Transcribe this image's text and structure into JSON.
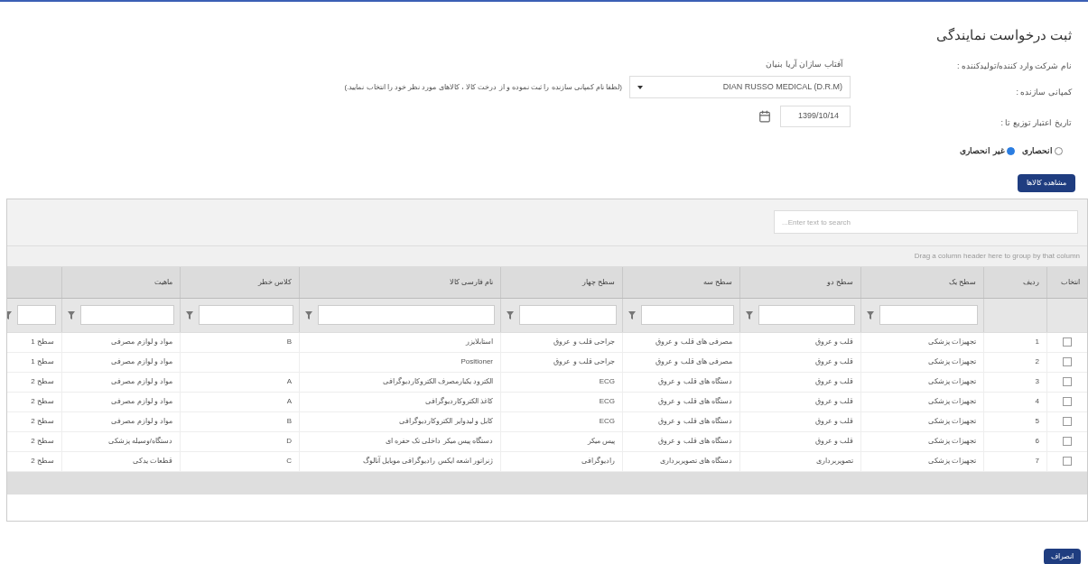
{
  "title": "ثبت درخواست نمایندگی",
  "form": {
    "company_label": "نام شرکت وارد کننده/تولیدکننده :",
    "company_value": "آفتاب سازان آریا بنیان",
    "manufacturer_label": "کمپانی سازنده :",
    "manufacturer_value": "DIAN RUSSO MEDICAL (D.R.M)",
    "manufacturer_hint": "(لطفا نام کمپانی سازنده را ثبت نموده و از درخت کالا ، کالاهای مورد نظر خود را انتخاب نمایید.)",
    "date_label": "تاریخ اعتبار توزیع تا :",
    "date_value": "1399/10/14",
    "radios": [
      {
        "label": "انحصاری",
        "selected": false
      },
      {
        "label": "غیر انحصاری",
        "selected": true
      }
    ],
    "view_button": "مشاهده کالاها"
  },
  "grid": {
    "search_placeholder": "Enter text to search...",
    "group_panel": "Drag a column header here to group by that column",
    "select_column_label": "انتخاب",
    "columns": [
      {
        "label": "ردیف",
        "kind": "plain"
      },
      {
        "label": "سطح یک",
        "kind": "filter"
      },
      {
        "label": "سطح دو",
        "kind": "filter"
      },
      {
        "label": "سطح سه",
        "kind": "filter"
      },
      {
        "label": "سطح چهار",
        "kind": "filter"
      },
      {
        "label": "نام فارسی کالا",
        "kind": "filter"
      },
      {
        "label": "کلاس خطر",
        "kind": "filter"
      },
      {
        "label": "ماهیت",
        "kind": "filter"
      },
      {
        "kind": "filter"
      }
    ],
    "rows": [
      {
        "checked": false,
        "cells": [
          "1",
          "تجهیزات پزشکی",
          "قلب و عروق",
          "مصرفی های قلب و عروق",
          "جراحی قلب و عروق",
          "استابلایزر",
          "B",
          "مواد و لوازم مصرفی",
          "سطح 1"
        ]
      },
      {
        "checked": false,
        "cells": [
          "2",
          "تجهیزات پزشکی",
          "قلب و عروق",
          "مصرفی های قلب و عروق",
          "جراحی قلب و عروق",
          "Positioner",
          "",
          "مواد و لوازم مصرفی",
          "سطح 1"
        ]
      },
      {
        "checked": false,
        "cells": [
          "3",
          "تجهیزات پزشکی",
          "قلب و عروق",
          "دستگاه های قلب و عروق",
          "ECG",
          "الکترود یکبارمصرف الکتروکاردیوگرافی",
          "A",
          "مواد و لوازم مصرفی",
          "سطح 2"
        ]
      },
      {
        "checked": false,
        "cells": [
          "4",
          "تجهیزات پزشکی",
          "قلب و عروق",
          "دستگاه های قلب و عروق",
          "ECG",
          "کاغذ الکتروکاردیوگرافی",
          "A",
          "مواد و لوازم مصرفی",
          "سطح 2"
        ]
      },
      {
        "checked": false,
        "cells": [
          "5",
          "تجهیزات پزشکی",
          "قلب و عروق",
          "دستگاه های قلب و عروق",
          "ECG",
          "کابل و لیدوایر الکتروکاردیوگرافی",
          "B",
          "مواد و لوازم مصرفی",
          "سطح 2"
        ]
      },
      {
        "checked": false,
        "cells": [
          "6",
          "تجهیزات پزشکی",
          "قلب و عروق",
          "دستگاه های قلب و عروق",
          "پیس میکر",
          "دستگاه پیس میکر داخلی تک حفره ای",
          "D",
          "دستگاه/وسیله پزشکی",
          "سطح 2"
        ]
      },
      {
        "checked": false,
        "cells": [
          "7",
          "تجهیزات پزشکی",
          "تصویربرداری",
          "دستگاه های تصویربرداری",
          "رادیوگرافی",
          "ژنراتور اشعه ایکس رادیوگرافی موبایل آنالوگ",
          "C",
          "قطعات یدکی",
          "سطح 2"
        ]
      }
    ]
  },
  "footer_button": "انصراف"
}
